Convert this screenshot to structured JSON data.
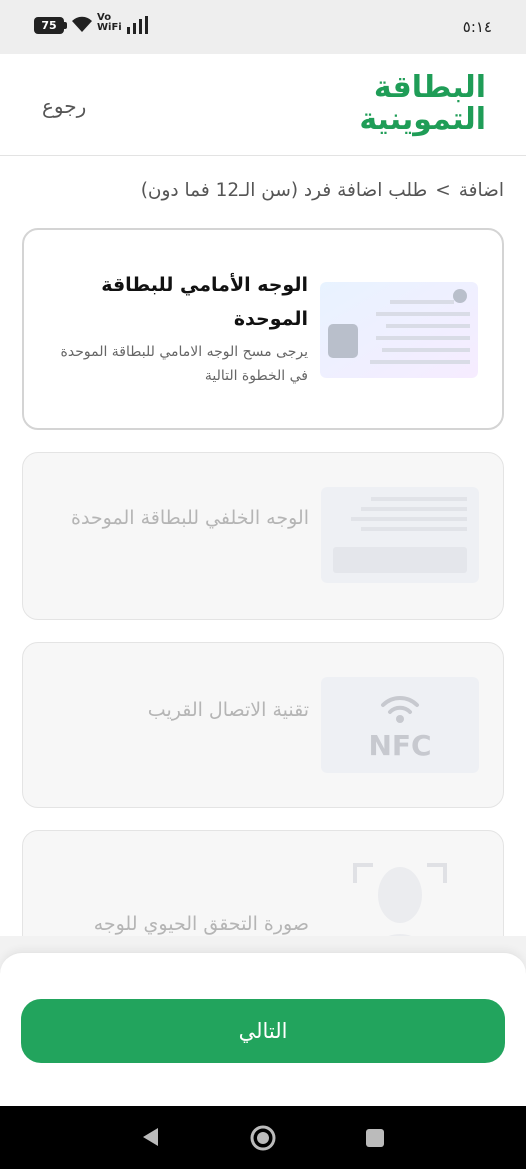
{
  "status_bar": {
    "battery": "75",
    "network_label": "Vo\nWiFi",
    "time": "٥:١٤"
  },
  "header": {
    "logo_line1": "البطاقة",
    "logo_line2": "التموينية",
    "back_label": "رجوع",
    "brand_color": "#1f9d57"
  },
  "breadcrumb": {
    "root": "اضافة",
    "separator": ">",
    "current": "طلب اضافة فرد (سن الـ12 فما دون)"
  },
  "steps": [
    {
      "title": "الوجه الأمامي للبطاقة الموحدة",
      "description": "يرجى مسح الوجه الامامي للبطاقة الموحدة في الخطوة التالية",
      "state": "active",
      "illustration": "id-card-front"
    },
    {
      "title": "الوجه الخلفي للبطاقة الموحدة",
      "state": "disabled",
      "illustration": "id-card-back"
    },
    {
      "title": "تقنية الاتصال القريب",
      "state": "disabled",
      "illustration": "nfc",
      "illustration_text": "NFC"
    },
    {
      "title": "صورة التحقق الحيوي للوجه",
      "state": "disabled",
      "illustration": "face-scan"
    }
  ],
  "footer": {
    "next_label": "التالي",
    "button_color": "#22a45d"
  }
}
